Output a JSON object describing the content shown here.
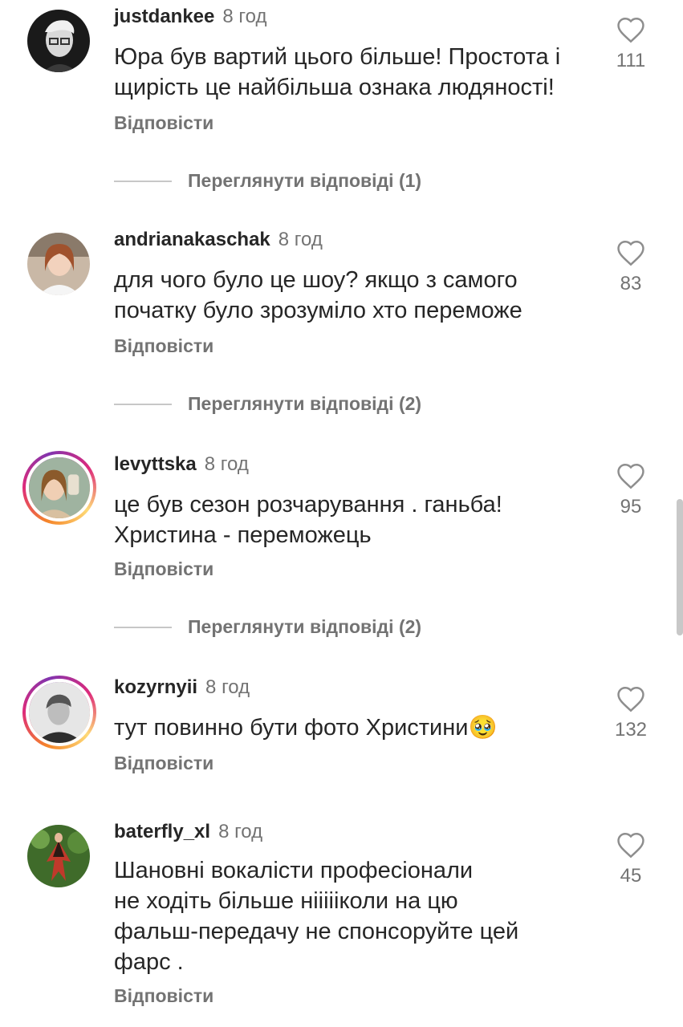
{
  "reply_label": "Відповісти",
  "comments": [
    {
      "username": "justdankee",
      "time": "8 год",
      "text": "Юра був вартий цього більше! Простота і щирість це найбільша ознака людяності!",
      "likes": "111",
      "view_replies": "Переглянути відповіді (1)"
    },
    {
      "username": "andrianakaschak",
      "time": "8 год",
      "text": "для чого було це шоу? якщо з самого початку було зрозуміло хто переможе",
      "likes": "83",
      "view_replies": "Переглянути відповіді (2)"
    },
    {
      "username": "levyttska",
      "time": "8 год",
      "text": "це був сезон розчарування . ганьба!\nХристина - переможець",
      "likes": "95",
      "view_replies": "Переглянути відповіді (2)"
    },
    {
      "username": "kozyrnyii",
      "time": "8 год",
      "text": "тут повинно бути фото Христини🥹",
      "likes": "132"
    },
    {
      "username": "baterfly_xl",
      "time": "8 год",
      "text": "Шановні вокалісти професіонали\nне ходіть більше ніііііколи на цю\nфальш-передачу не спонсоруйте цей\nфарс .",
      "likes": "45"
    }
  ],
  "icons": {
    "like": "heart-outline-icon"
  },
  "colors": {
    "text": "#262626",
    "secondary": "#737373",
    "story_ring": "#dd2a7b"
  }
}
